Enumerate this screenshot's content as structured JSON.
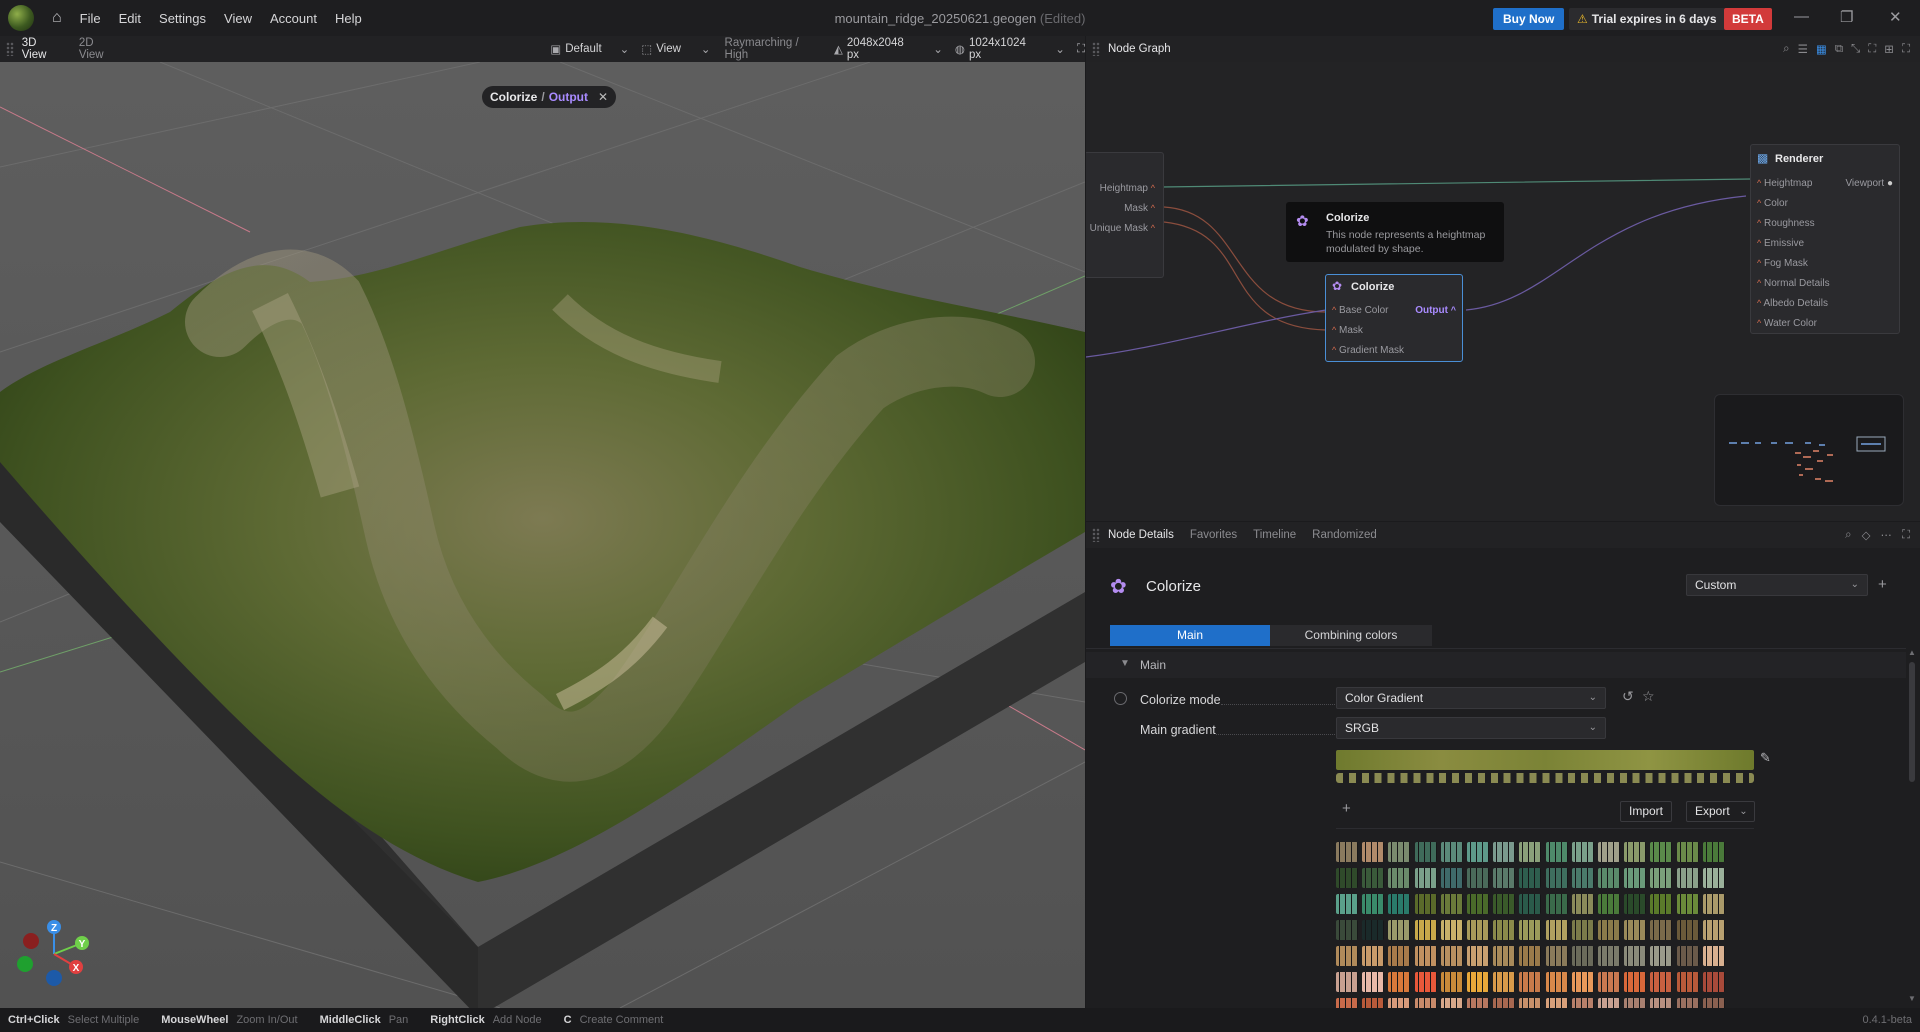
{
  "menubar": {
    "items": [
      "File",
      "Edit",
      "Settings",
      "View",
      "Account",
      "Help"
    ],
    "title": "mountain_ridge_20250621.geogen",
    "title_suffix": "(Edited)",
    "buy_label": "Buy Now",
    "trial_label": "Trial expires in 6 days",
    "beta_label": "BETA"
  },
  "viewport_toolbar": {
    "tabs": [
      "3D View",
      "2D View"
    ],
    "default_label": "Default",
    "view_label": "View",
    "render_mode": "Raymarching / High",
    "resolution": "2048x2048 px",
    "preview_res": "1024x1024 px"
  },
  "viewport": {
    "breadcrumb_node": "Colorize",
    "breadcrumb_sep": "/",
    "breadcrumb_port": "Output",
    "gizmo": {
      "z": "Z",
      "y": "Y",
      "x": "X"
    }
  },
  "nodegraph": {
    "title": "Node Graph",
    "left_node_ports": [
      "Heightmap",
      "Mask",
      "Unique Mask"
    ],
    "tooltip_title": "Colorize",
    "tooltip_text": "This node represents a heightmap modulated by shape.",
    "colorize_node": {
      "title": "Colorize",
      "inputs": [
        "Base Color",
        "Mask",
        "Gradient Mask"
      ],
      "output": "Output"
    },
    "renderer_node": {
      "title": "Renderer",
      "inputs": [
        "Heightmap",
        "Color",
        "Roughness",
        "Emissive",
        "Fog Mask",
        "Normal Details",
        "Albedo Details",
        "Water Color"
      ],
      "output": "Viewport"
    }
  },
  "details_toolbar": {
    "tabs": [
      "Node Details",
      "Favorites",
      "Timeline",
      "Randomized"
    ]
  },
  "details": {
    "node_title": "Colorize",
    "preset": "Custom",
    "tabs": [
      "Main",
      "Combining colors"
    ],
    "section": "Main",
    "colorize_mode_label": "Colorize mode",
    "colorize_mode_value": "Color Gradient",
    "main_gradient_label": "Main gradient",
    "main_gradient_value": "SRGB",
    "import_label": "Import",
    "export_label": "Export"
  },
  "statusbar": {
    "hints": [
      {
        "key": "Ctrl+Click",
        "value": "Select Multiple"
      },
      {
        "key": "MouseWheel",
        "value": "Zoom In/Out"
      },
      {
        "key": "MiddleClick",
        "value": "Pan"
      },
      {
        "key": "RightClick",
        "value": "Add Node"
      },
      {
        "key": "C",
        "value": "Create Comment"
      }
    ],
    "version": "0.4.1-beta"
  },
  "colors": {
    "accent": "#1f6fc9",
    "beta": "#d23a3a",
    "port_out": "#a98bff"
  }
}
